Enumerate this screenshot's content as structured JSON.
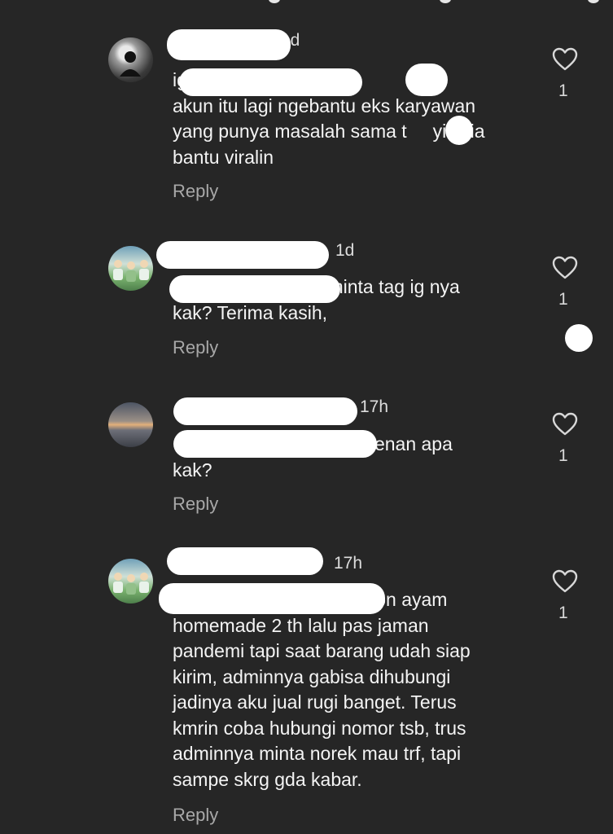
{
  "comments": [
    {
      "time": "1d",
      "text": "ig b           ji kak,\nakun itu lagi ngebantu eks karyawan\nyang punya masalah sama t     yi. Dia\nbantu viralin",
      "reply_label": "Reply",
      "likes": "1",
      "avatar": "dark-figure"
    },
    {
      "time": "1d",
      "text": "                    boleh minta tag ig nya\nkak? Terima kasih,",
      "reply_label": "Reply",
      "likes": "1",
      "avatar": "group-photo"
    },
    {
      "time": "17h",
      "text": "                                   esenan apa\nkak?",
      "reply_label": "Reply",
      "likes": "1",
      "avatar": "sunset"
    },
    {
      "time": "17h",
      "text": "                                   abon ayam\nhomemade 2 th lalu pas jaman\npandemi tapi saat barang udah siap\nkirim, adminnya gabisa dihubungi\njadinya aku jual rugi banget. Terus\nkmrin coba hubungi nomor tsb, trus\nadminnya minta norek mau trf, tapi\nsampe skrg gda kabar.",
      "reply_label": "Reply",
      "likes": "1",
      "avatar": "group-photo"
    }
  ],
  "icons": {
    "like": "heart-outline-icon"
  },
  "colors": {
    "background": "#262626",
    "text": "#f4f4f4",
    "muted": "#a8a8a8",
    "redaction": "#ffffff"
  }
}
